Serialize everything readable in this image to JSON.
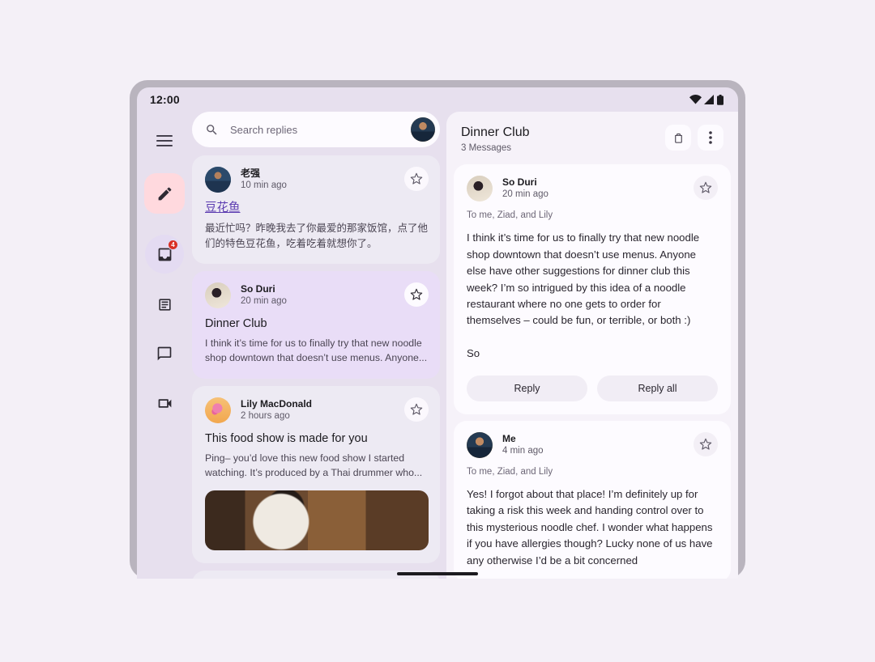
{
  "status_bar": {
    "time": "12:00",
    "icons": [
      "wifi-icon",
      "signal-icon",
      "battery-icon"
    ]
  },
  "nav_rail": {
    "items": [
      {
        "name": "menu",
        "icon": "hamburger-menu-icon",
        "label": "Menu",
        "state": "default"
      },
      {
        "name": "compose",
        "icon": "pencil-edit-icon",
        "label": "Compose",
        "state": "fab"
      },
      {
        "name": "inbox",
        "icon": "inbox-icon",
        "label": "Inbox",
        "state": "active",
        "badge": "4"
      },
      {
        "name": "articles",
        "icon": "article-icon",
        "label": "Articles",
        "state": "default"
      },
      {
        "name": "chat",
        "icon": "chat-bubble-icon",
        "label": "Chat",
        "state": "default"
      },
      {
        "name": "meet",
        "icon": "video-camera-icon",
        "label": "Meet",
        "state": "default"
      }
    ]
  },
  "search": {
    "placeholder": "Search replies",
    "value": "",
    "icon": "search-icon",
    "avatar": "user-avatar"
  },
  "email_list": [
    {
      "sender": "老强",
      "time": "10 min ago",
      "subject": "豆花鱼",
      "subject_is_link": true,
      "snippet": "最近忙吗？昨晚我去了你最爱的那家饭馆，点了他们的特色豆花鱼，吃着吃着就想你了。",
      "selected": false,
      "starred": false,
      "has_image": false
    },
    {
      "sender": "So Duri",
      "time": "20 min ago",
      "subject": "Dinner Club",
      "subject_is_link": false,
      "snippet": "I think it’s time for us to finally try that new noodle shop downtown that doesn’t use menus. Anyone...",
      "selected": true,
      "starred": false,
      "has_image": false
    },
    {
      "sender": "Lily MacDonald",
      "time": "2 hours ago",
      "subject": "This food show is made for you",
      "subject_is_link": false,
      "snippet": "Ping– you’d love this new food show I started watching. It’s produced by a Thai drummer who...",
      "selected": false,
      "starred": false,
      "has_image": true,
      "image_alt": "woman-cooking-in-kitchen"
    }
  ],
  "detail": {
    "title": "Dinner Club",
    "subtitle": "3 Messages",
    "actions": [
      {
        "name": "delete",
        "icon": "trash-icon",
        "label": "Delete"
      },
      {
        "name": "more",
        "icon": "more-vertical-icon",
        "label": "More options"
      }
    ],
    "messages": [
      {
        "sender": "So Duri",
        "time": "20 min ago",
        "recipients": "To me, Ziad, and Lily",
        "body": "I think it’s time for us to finally try that new noodle shop downtown that doesn’t use menus. Anyone else have other suggestions for dinner club this week? I’m so intrigued by this idea of a noodle restaurant where no one gets to order for themselves – could be fun, or terrible, or both :)\n\nSo",
        "starred": false,
        "reply_label": "Reply",
        "reply_all_label": "Reply all",
        "show_replies": true
      },
      {
        "sender": "Me",
        "time": "4 min ago",
        "recipients": "To me, Ziad, and Lily",
        "body": "Yes! I forgot about that place! I’m definitely up for taking a risk this week and handing control over to this mysterious noodle chef. I wonder what happens if you have allergies though? Lucky none of us have any otherwise I’d be a bit concerned",
        "starred": false,
        "show_replies": false
      }
    ]
  },
  "colors": {
    "app_background": "#e7e0ee",
    "page_background": "#f4f0f7",
    "card": "#edeaf3",
    "card_selected": "#e9ddf7",
    "surface": "#fdfbff",
    "fab": "#ffd9de",
    "nav_active": "#e4dbf2",
    "badge": "#d93025",
    "link": "#5b3bb0",
    "text_primary": "#1c1b1f",
    "text_secondary": "#5f5a68"
  }
}
